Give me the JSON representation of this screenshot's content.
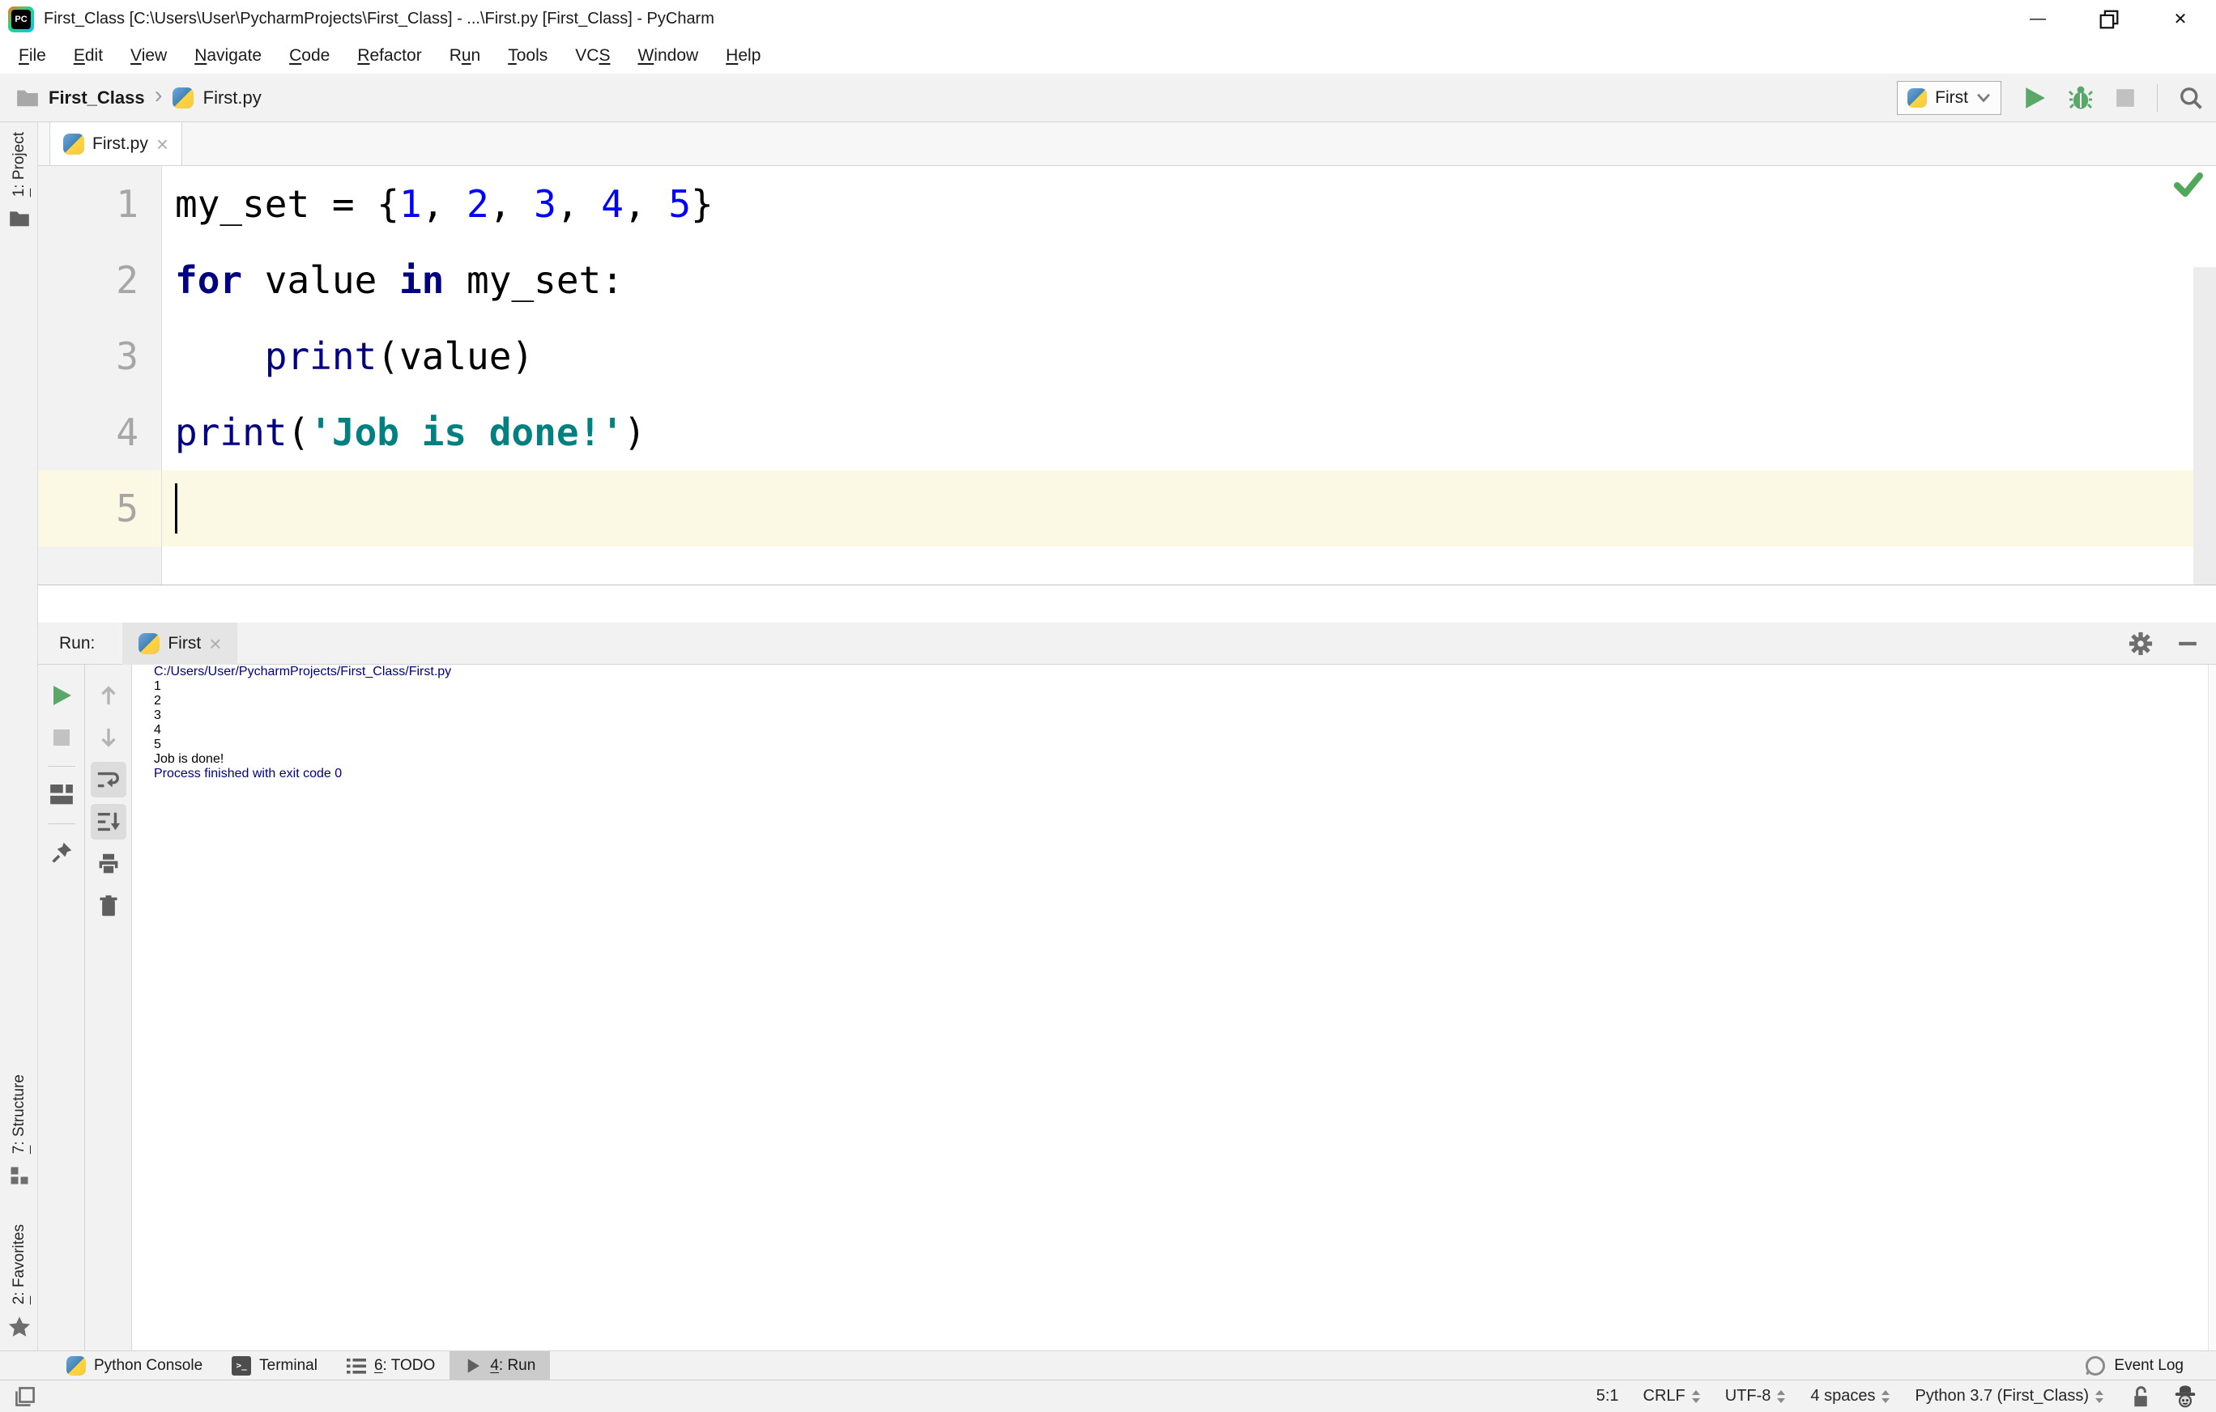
{
  "window": {
    "title": "First_Class [C:\\Users\\User\\PycharmProjects\\First_Class] - ...\\First.py [First_Class] - PyCharm",
    "logo_text": "PC",
    "minimize_glyph": "—",
    "close_glyph": "✕"
  },
  "menu": {
    "items": [
      {
        "pre": "",
        "u": "F",
        "post": "ile"
      },
      {
        "pre": "",
        "u": "E",
        "post": "dit"
      },
      {
        "pre": "",
        "u": "V",
        "post": "iew"
      },
      {
        "pre": "",
        "u": "N",
        "post": "avigate"
      },
      {
        "pre": "",
        "u": "C",
        "post": "ode"
      },
      {
        "pre": "",
        "u": "R",
        "post": "efactor"
      },
      {
        "pre": "R",
        "u": "u",
        "post": "n"
      },
      {
        "pre": "",
        "u": "T",
        "post": "ools"
      },
      {
        "pre": "VC",
        "u": "S",
        "post": ""
      },
      {
        "pre": "",
        "u": "W",
        "post": "indow"
      },
      {
        "pre": "",
        "u": "H",
        "post": "elp"
      }
    ]
  },
  "toolbar": {
    "breadcrumb": {
      "project": "First_Class",
      "separator": "›",
      "file": "First.py"
    },
    "run_config": "First"
  },
  "tool_strip": {
    "project": {
      "u": "1",
      "post": ": Project"
    },
    "structure": {
      "u": "7",
      "post": ": Structure"
    },
    "favorites": {
      "u": "2",
      "post": ": Favorites"
    }
  },
  "editor": {
    "tab": "First.py",
    "tab_close": "×",
    "lines": [
      {
        "num": "1",
        "segments": [
          {
            "text": "my_set = {",
            "style": "plain"
          },
          {
            "text": "1",
            "style": "number"
          },
          {
            "text": ", ",
            "style": "plain"
          },
          {
            "text": "2",
            "style": "number"
          },
          {
            "text": ", ",
            "style": "plain"
          },
          {
            "text": "3",
            "style": "number"
          },
          {
            "text": ", ",
            "style": "plain"
          },
          {
            "text": "4",
            "style": "number"
          },
          {
            "text": ", ",
            "style": "plain"
          },
          {
            "text": "5",
            "style": "number"
          },
          {
            "text": "}",
            "style": "plain"
          }
        ]
      },
      {
        "num": "2",
        "segments": [
          {
            "text": "for",
            "style": "keyword"
          },
          {
            "text": " value ",
            "style": "plain"
          },
          {
            "text": "in",
            "style": "keyword"
          },
          {
            "text": " my_set:",
            "style": "plain"
          }
        ]
      },
      {
        "num": "3",
        "segments": [
          {
            "text": "    ",
            "style": "plain"
          },
          {
            "text": "print",
            "style": "builtin"
          },
          {
            "text": "(value)",
            "style": "plain"
          }
        ]
      },
      {
        "num": "4",
        "segments": [
          {
            "text": "print",
            "style": "builtin"
          },
          {
            "text": "(",
            "style": "plain"
          },
          {
            "text": "'Job is done!'",
            "style": "string"
          },
          {
            "text": ")",
            "style": "plain"
          }
        ]
      },
      {
        "num": "5",
        "segments": []
      }
    ]
  },
  "run_panel": {
    "label": "Run:",
    "tab": "First",
    "tab_close": "×"
  },
  "console": {
    "lines": [
      {
        "text": " C:/Users/User/PycharmProjects/First_Class/First.py",
        "style": "system"
      },
      {
        "text": "1",
        "style": "stdout"
      },
      {
        "text": "2",
        "style": "stdout"
      },
      {
        "text": "3",
        "style": "stdout"
      },
      {
        "text": "4",
        "style": "stdout"
      },
      {
        "text": "5",
        "style": "stdout"
      },
      {
        "text": "Job is done!",
        "style": "stdout"
      },
      {
        "text": "",
        "style": "stdout"
      },
      {
        "text": "Process finished with exit code 0",
        "style": "system"
      }
    ]
  },
  "bottom_bar": {
    "items": [
      {
        "pre": "Python Console",
        "u": "",
        "post": ""
      },
      {
        "pre": "Terminal",
        "u": "",
        "post": ""
      },
      {
        "pre": "",
        "u": "6",
        "post": ": TODO"
      },
      {
        "pre": "",
        "u": "4",
        "post": ": Run"
      }
    ],
    "event_log": "Event Log"
  },
  "status_bar": {
    "position": "5:1",
    "line_ending": "CRLF",
    "encoding": "UTF-8",
    "indent": "4 spaces",
    "interpreter": "Python 3.7 (First_Class)"
  },
  "colors": {
    "keyword": "#000080",
    "number": "#0000FF",
    "string": "#008080",
    "builtin": "#000080",
    "console_system": "#000080",
    "accent_green": "#59A869",
    "current_line": "#FBF8E3"
  }
}
